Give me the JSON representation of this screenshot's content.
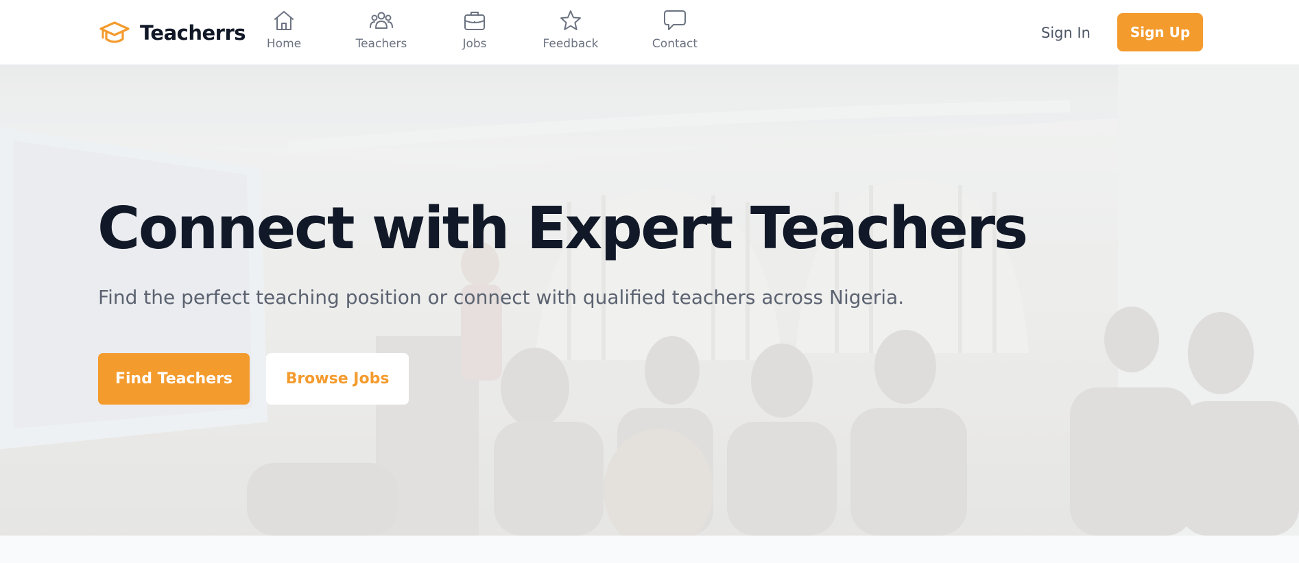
{
  "brand": {
    "name": "Teacherrs",
    "accent_color": "#f49b2e",
    "icon": "graduation-cap-icon"
  },
  "nav": {
    "items": [
      {
        "label": "Home",
        "icon": "home-icon"
      },
      {
        "label": "Teachers",
        "icon": "users-icon"
      },
      {
        "label": "Jobs",
        "icon": "briefcase-icon"
      },
      {
        "label": "Feedback",
        "icon": "star-icon"
      },
      {
        "label": "Contact",
        "icon": "chat-bubble-icon"
      }
    ]
  },
  "auth": {
    "sign_in_label": "Sign In",
    "sign_up_label": "Sign Up"
  },
  "hero": {
    "title": "Connect with Expert Teachers",
    "subtitle": "Find the perfect teaching position or connect with qualified teachers across Nigeria.",
    "primary_cta": "Find Teachers",
    "secondary_cta": "Browse Jobs",
    "background": "classroom-photo"
  },
  "colors": {
    "title_text": "#111827",
    "subtitle_text": "#5b6270",
    "nav_text": "#6b7280",
    "page_background": "#f9fafb"
  }
}
